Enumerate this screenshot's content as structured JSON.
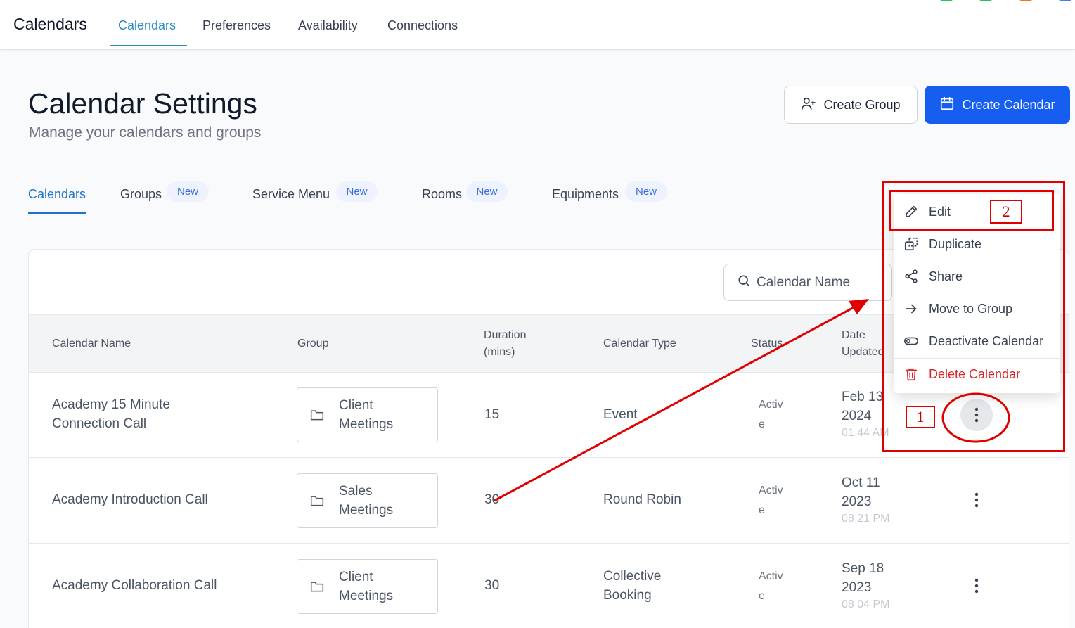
{
  "topnav": {
    "brand": "Calendars",
    "items": [
      {
        "label": "Calendars",
        "active": true
      },
      {
        "label": "Preferences"
      },
      {
        "label": "Availability"
      },
      {
        "label": "Connections"
      }
    ]
  },
  "header": {
    "title": "Calendar Settings",
    "subtitle": "Manage your calendars and groups",
    "create_group_label": "Create Group",
    "create_calendar_label": "Create Calendar"
  },
  "subtabs": [
    {
      "label": "Calendars",
      "active": true,
      "badge": ""
    },
    {
      "label": "Groups",
      "badge": "New"
    },
    {
      "label": "Service Menu",
      "badge": "New"
    },
    {
      "label": "Rooms",
      "badge": "New"
    },
    {
      "label": "Equipments",
      "badge": "New"
    }
  ],
  "search": {
    "placeholder": "Calendar Name"
  },
  "table": {
    "headers": {
      "name": "Calendar Name",
      "group": "Group",
      "duration_1": "Duration",
      "duration_2": "(mins)",
      "type": "Calendar Type",
      "status": "Status",
      "date_1": "Date",
      "date_2": "Updated"
    },
    "rows": [
      {
        "name_1": "Academy 15 Minute",
        "name_2": "Connection Call",
        "group_1": "Client",
        "group_2": "Meetings",
        "duration": "15",
        "type_1": "Event",
        "type_2": "",
        "status_1": "Activ",
        "status_2": "e",
        "date_1": "Feb 13",
        "date_2": "2024",
        "time": "01 44 AM"
      },
      {
        "name_1": "Academy Introduction Call",
        "name_2": "",
        "group_1": "Sales",
        "group_2": "Meetings",
        "duration": "30",
        "type_1": "Round Robin",
        "type_2": "",
        "status_1": "Activ",
        "status_2": "e",
        "date_1": "Oct 11",
        "date_2": "2023",
        "time": "08 21 PM"
      },
      {
        "name_1": "Academy Collaboration Call",
        "name_2": "",
        "group_1": "Client",
        "group_2": "Meetings",
        "duration": "30",
        "type_1": "Collective",
        "type_2": "Booking",
        "status_1": "Activ",
        "status_2": "e",
        "date_1": "Sep 18",
        "date_2": "2023",
        "time": "08 04 PM"
      }
    ]
  },
  "menu": {
    "items": [
      {
        "label": "Edit",
        "icon": "pencil-icon"
      },
      {
        "label": "Duplicate",
        "icon": "duplicate-icon"
      },
      {
        "label": "Share",
        "icon": "share-icon"
      },
      {
        "label": "Move to Group",
        "icon": "arrow-right-icon"
      },
      {
        "label": "Deactivate Calendar",
        "icon": "toggle-icon"
      },
      {
        "label": "Delete Calendar",
        "icon": "trash-icon"
      }
    ]
  },
  "annotations": {
    "one": "1",
    "two": "2"
  },
  "colors": {
    "primary": "#155eef",
    "nav_active": "#2b8cc4",
    "danger": "#dc2626",
    "annotation": "#e00000"
  }
}
